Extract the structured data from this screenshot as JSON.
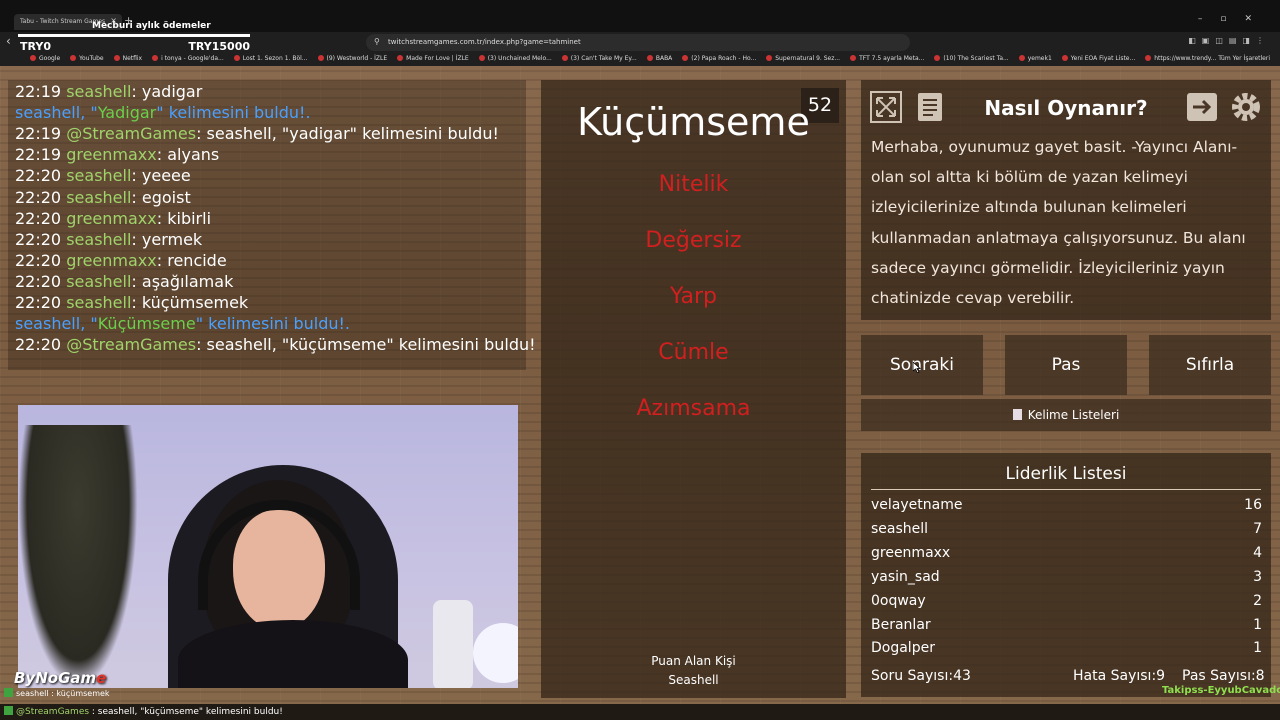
{
  "browser": {
    "tab_title": "Tabu - Twitch Stream Games",
    "overlay_title": "Mecburi aylık ödemeler",
    "url": "twitchstreamgames.com.tr/index.php?game=tahminet",
    "bookmarks": [
      "Google",
      "YouTube",
      "Netflix",
      "i tonya - Google'da...",
      "Lost 1. Sezon 1. Böl...",
      "(9) Westworld - İZLE",
      "Made For Love | İZLE",
      "(3) Unchained Melo...",
      "(3) Can't Take My Ey...",
      "BABA",
      "(2) Papa Roach - Ho...",
      "Supernatural 9. Sez...",
      "TFT 7.5 ayarla Meta...",
      "(10) The Scariest Ta...",
      "yemek1",
      "Yeni EOA Fiyat Liste...",
      "https://www.trendy..."
    ],
    "bookmarks_right": "Tüm Yer İşaretleri"
  },
  "overlay": {
    "try_left": "TRY0",
    "try_right": "TRY15000"
  },
  "chat": [
    {
      "time": "22:19",
      "user": "seashell",
      "msg": ": yadigar"
    },
    {
      "notice": true,
      "pre": "seashell, \"",
      "hl": "Yadigar",
      "post": "\" kelimesini buldu!."
    },
    {
      "time": "22:19",
      "bot": "@StreamGames",
      "msg": ": seashell, \"yadigar\" kelimesini buldu!"
    },
    {
      "time": "22:19",
      "user": "greenmaxx",
      "msg": ": alyans"
    },
    {
      "time": "22:20",
      "user": "seashell",
      "msg": ": yeeee"
    },
    {
      "time": "22:20",
      "user": "seashell",
      "msg": ": egoist"
    },
    {
      "time": "22:20",
      "user": "greenmaxx",
      "msg": ": kibirli"
    },
    {
      "time": "22:20",
      "user": "seashell",
      "msg": ": yermek"
    },
    {
      "time": "22:20",
      "user": "greenmaxx",
      "msg": ": rencide"
    },
    {
      "time": "22:20",
      "user": "seashell",
      "msg": ": aşağılamak"
    },
    {
      "time": "22:20",
      "user": "seashell",
      "msg": ": küçümsemek"
    },
    {
      "notice": true,
      "pre": "seashell, \"",
      "hl": "Küçümseme",
      "post": "\" kelimesini buldu!."
    },
    {
      "time": "22:20",
      "bot": "@StreamGames",
      "msg": ": seashell, \"küçümseme\" kelimesini buldu!"
    }
  ],
  "stream": {
    "logo_text": "ByNoGam",
    "logo_e": "e",
    "ticker_user": "seashell",
    "ticker_msg": " : küçümsemek",
    "ticker2_user": "@StreamGames",
    "ticker2_msg": " : seashell, \"küçümseme\" kelimesini buldu!"
  },
  "game": {
    "timer": "52",
    "main_word": "Küçümseme",
    "taboo_words": [
      "Nitelik",
      "Değersiz",
      "Yarp",
      "Cümle",
      "Azımsama"
    ],
    "scorer_label": "Puan Alan Kişi",
    "scorer_name": "Seashell"
  },
  "howto": {
    "title": "Nasıl Oynanır?",
    "text": "Merhaba, oyunumuz gayet basit. -Yayıncı Alanı- olan sol altta ki bölüm de yazan kelimeyi izleyicilerinize altında bulunan kelimeleri kullanmadan anlatmaya çalışıyorsunuz. Bu alanı sadece yayıncı görmelidir. İzleyicileriniz yayın chatinizde cevap verebilir.",
    "icons": [
      "fullscreen-icon",
      "notes-icon",
      "exit-icon",
      "settings-icon"
    ]
  },
  "controls": {
    "next": "Sonraki",
    "pass": "Pas",
    "reset": "Sıfırla",
    "word_lists": "Kelime Listeleri"
  },
  "leaderboard": {
    "title": "Liderlik Listesi",
    "rows": [
      {
        "name": "velayetname",
        "score": "16"
      },
      {
        "name": "seashell",
        "score": "7"
      },
      {
        "name": "greenmaxx",
        "score": "4"
      },
      {
        "name": "yasin_sad",
        "score": "3"
      },
      {
        "name": "0oqway",
        "score": "2"
      },
      {
        "name": "Beranlar",
        "score": "1"
      },
      {
        "name": "Dogalper",
        "score": "1"
      }
    ],
    "question_count": "Soru Sayısı:43",
    "error_count": "Hata Sayısı:9",
    "pass_count": "Pas Sayısı:8"
  },
  "follow_text": "Takipss-EyyubCavadovl",
  "colors": {
    "taboo": "#d21f1f",
    "chat_user": "#a0d36a",
    "chat_notice": "#4aa0ff",
    "wood": "#7a5a3e"
  }
}
